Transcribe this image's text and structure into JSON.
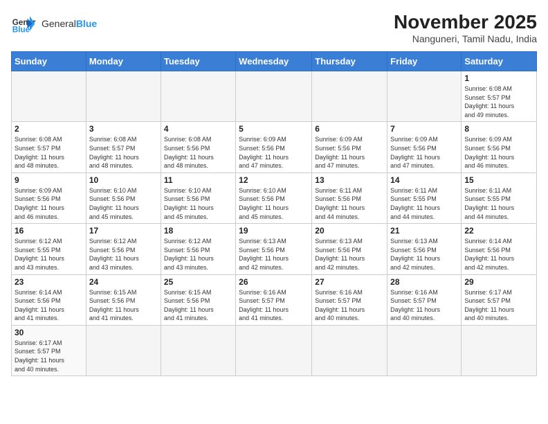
{
  "header": {
    "logo_general": "General",
    "logo_blue": "Blue",
    "month_year": "November 2025",
    "location": "Nanguneri, Tamil Nadu, India"
  },
  "days_of_week": [
    "Sunday",
    "Monday",
    "Tuesday",
    "Wednesday",
    "Thursday",
    "Friday",
    "Saturday"
  ],
  "weeks": [
    [
      {
        "day": null,
        "info": null
      },
      {
        "day": null,
        "info": null
      },
      {
        "day": null,
        "info": null
      },
      {
        "day": null,
        "info": null
      },
      {
        "day": null,
        "info": null
      },
      {
        "day": null,
        "info": null
      },
      {
        "day": "1",
        "info": "Sunrise: 6:08 AM\nSunset: 5:57 PM\nDaylight: 11 hours\nand 49 minutes."
      }
    ],
    [
      {
        "day": "2",
        "info": "Sunrise: 6:08 AM\nSunset: 5:57 PM\nDaylight: 11 hours\nand 48 minutes."
      },
      {
        "day": "3",
        "info": "Sunrise: 6:08 AM\nSunset: 5:57 PM\nDaylight: 11 hours\nand 48 minutes."
      },
      {
        "day": "4",
        "info": "Sunrise: 6:08 AM\nSunset: 5:56 PM\nDaylight: 11 hours\nand 48 minutes."
      },
      {
        "day": "5",
        "info": "Sunrise: 6:09 AM\nSunset: 5:56 PM\nDaylight: 11 hours\nand 47 minutes."
      },
      {
        "day": "6",
        "info": "Sunrise: 6:09 AM\nSunset: 5:56 PM\nDaylight: 11 hours\nand 47 minutes."
      },
      {
        "day": "7",
        "info": "Sunrise: 6:09 AM\nSunset: 5:56 PM\nDaylight: 11 hours\nand 47 minutes."
      },
      {
        "day": "8",
        "info": "Sunrise: 6:09 AM\nSunset: 5:56 PM\nDaylight: 11 hours\nand 46 minutes."
      }
    ],
    [
      {
        "day": "9",
        "info": "Sunrise: 6:09 AM\nSunset: 5:56 PM\nDaylight: 11 hours\nand 46 minutes."
      },
      {
        "day": "10",
        "info": "Sunrise: 6:10 AM\nSunset: 5:56 PM\nDaylight: 11 hours\nand 45 minutes."
      },
      {
        "day": "11",
        "info": "Sunrise: 6:10 AM\nSunset: 5:56 PM\nDaylight: 11 hours\nand 45 minutes."
      },
      {
        "day": "12",
        "info": "Sunrise: 6:10 AM\nSunset: 5:56 PM\nDaylight: 11 hours\nand 45 minutes."
      },
      {
        "day": "13",
        "info": "Sunrise: 6:11 AM\nSunset: 5:56 PM\nDaylight: 11 hours\nand 44 minutes."
      },
      {
        "day": "14",
        "info": "Sunrise: 6:11 AM\nSunset: 5:55 PM\nDaylight: 11 hours\nand 44 minutes."
      },
      {
        "day": "15",
        "info": "Sunrise: 6:11 AM\nSunset: 5:55 PM\nDaylight: 11 hours\nand 44 minutes."
      }
    ],
    [
      {
        "day": "16",
        "info": "Sunrise: 6:12 AM\nSunset: 5:55 PM\nDaylight: 11 hours\nand 43 minutes."
      },
      {
        "day": "17",
        "info": "Sunrise: 6:12 AM\nSunset: 5:56 PM\nDaylight: 11 hours\nand 43 minutes."
      },
      {
        "day": "18",
        "info": "Sunrise: 6:12 AM\nSunset: 5:56 PM\nDaylight: 11 hours\nand 43 minutes."
      },
      {
        "day": "19",
        "info": "Sunrise: 6:13 AM\nSunset: 5:56 PM\nDaylight: 11 hours\nand 42 minutes."
      },
      {
        "day": "20",
        "info": "Sunrise: 6:13 AM\nSunset: 5:56 PM\nDaylight: 11 hours\nand 42 minutes."
      },
      {
        "day": "21",
        "info": "Sunrise: 6:13 AM\nSunset: 5:56 PM\nDaylight: 11 hours\nand 42 minutes."
      },
      {
        "day": "22",
        "info": "Sunrise: 6:14 AM\nSunset: 5:56 PM\nDaylight: 11 hours\nand 42 minutes."
      }
    ],
    [
      {
        "day": "23",
        "info": "Sunrise: 6:14 AM\nSunset: 5:56 PM\nDaylight: 11 hours\nand 41 minutes."
      },
      {
        "day": "24",
        "info": "Sunrise: 6:15 AM\nSunset: 5:56 PM\nDaylight: 11 hours\nand 41 minutes."
      },
      {
        "day": "25",
        "info": "Sunrise: 6:15 AM\nSunset: 5:56 PM\nDaylight: 11 hours\nand 41 minutes."
      },
      {
        "day": "26",
        "info": "Sunrise: 6:16 AM\nSunset: 5:57 PM\nDaylight: 11 hours\nand 41 minutes."
      },
      {
        "day": "27",
        "info": "Sunrise: 6:16 AM\nSunset: 5:57 PM\nDaylight: 11 hours\nand 40 minutes."
      },
      {
        "day": "28",
        "info": "Sunrise: 6:16 AM\nSunset: 5:57 PM\nDaylight: 11 hours\nand 40 minutes."
      },
      {
        "day": "29",
        "info": "Sunrise: 6:17 AM\nSunset: 5:57 PM\nDaylight: 11 hours\nand 40 minutes."
      }
    ],
    [
      {
        "day": "30",
        "info": "Sunrise: 6:17 AM\nSunset: 5:57 PM\nDaylight: 11 hours\nand 40 minutes."
      },
      {
        "day": null,
        "info": null
      },
      {
        "day": null,
        "info": null
      },
      {
        "day": null,
        "info": null
      },
      {
        "day": null,
        "info": null
      },
      {
        "day": null,
        "info": null
      },
      {
        "day": null,
        "info": null
      }
    ]
  ]
}
